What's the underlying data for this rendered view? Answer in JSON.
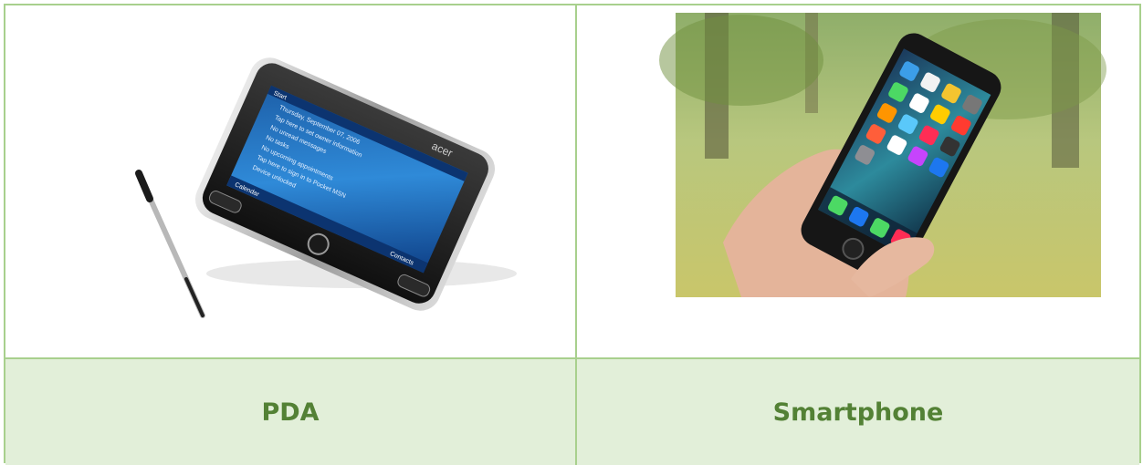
{
  "table": {
    "labels": {
      "pda": "PDA",
      "smartphone": "Smartphone"
    },
    "pda_image": {
      "brand_text": "acer",
      "screen_title": "Start",
      "screen_lines": [
        "Thursday, September 07, 2006",
        "Tap here to set owner information",
        "No unread messages",
        "No tasks",
        "No upcoming appointments",
        "Tap here to sign in to Pocket MSN",
        "Device unlocked"
      ],
      "softkeys": {
        "left": "Calendar",
        "right": "Contacts"
      }
    }
  },
  "colors": {
    "border": "#a8d08d",
    "label_bg": "#e2efd9",
    "label_text": "#538135"
  }
}
